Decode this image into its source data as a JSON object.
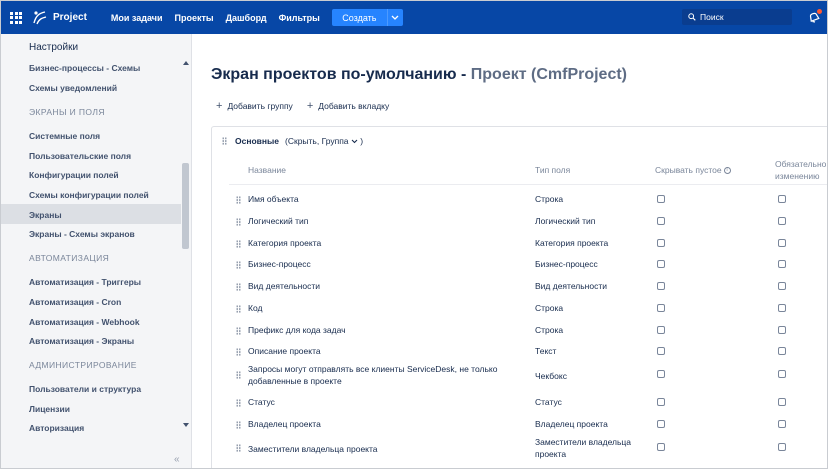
{
  "topbar": {
    "brand": "Project",
    "nav": [
      "Мои задачи",
      "Проекты",
      "Дашборд",
      "Фильтры"
    ],
    "create_label": "Создать",
    "search_placeholder": "Поиск"
  },
  "sidebar": {
    "title": "Настройки",
    "items": [
      {
        "type": "item",
        "label": "Бизнес-процессы - Схемы"
      },
      {
        "type": "item",
        "label": "Схемы уведомлений"
      },
      {
        "type": "head",
        "label": "ЭКРАНЫ И ПОЛЯ"
      },
      {
        "type": "item",
        "label": "Системные поля"
      },
      {
        "type": "item",
        "label": "Пользовательские поля"
      },
      {
        "type": "item",
        "label": "Конфигурации полей"
      },
      {
        "type": "item",
        "label": "Схемы конфигурации полей"
      },
      {
        "type": "item",
        "label": "Экраны"
      },
      {
        "type": "item",
        "label": "Экраны - Схемы экранов"
      },
      {
        "type": "head",
        "label": "АВТОМАТИЗАЦИЯ"
      },
      {
        "type": "item",
        "label": "Автоматизация - Триггеры"
      },
      {
        "type": "item",
        "label": "Автоматизация - Cron"
      },
      {
        "type": "item",
        "label": "Автоматизация - Webhook"
      },
      {
        "type": "item",
        "label": "Автоматизация - Экраны"
      },
      {
        "type": "head",
        "label": "АДМИНИСТРИРОВАНИЕ"
      },
      {
        "type": "item",
        "label": "Пользователи и структура"
      },
      {
        "type": "item",
        "label": "Лицензии"
      },
      {
        "type": "item",
        "label": "Авторизация"
      }
    ],
    "active": "Экраны",
    "collapse_glyph": "«"
  },
  "main": {
    "title": "Экран проектов по-умолчанию - ",
    "title_project": "Проект (CmfProject)",
    "add_group": "Добавить группу",
    "add_tab": "Добавить вкладку",
    "group_name": "Основные",
    "group_meta": "(Скрыть, Группа",
    "group_meta_end": ")",
    "columns": {
      "name": "Название",
      "type": "Тип поля",
      "hide_empty": "Скрывать пустое",
      "required_1": "Обязательно",
      "required_2": "изменению"
    },
    "rows": [
      {
        "name": "Имя объекта",
        "type": "Строка"
      },
      {
        "name": "Логический тип",
        "type": "Логический тип"
      },
      {
        "name": "Категория проекта",
        "type": "Категория проекта"
      },
      {
        "name": "Бизнес-процесс",
        "type": "Бизнес-процесс"
      },
      {
        "name": "Вид деятельности",
        "type": "Вид деятельности"
      },
      {
        "name": "Код",
        "type": "Строка"
      },
      {
        "name": "Префикс для кода задач",
        "type": "Строка"
      },
      {
        "name": "Описание проекта",
        "type": "Текст"
      },
      {
        "name": "Запросы могут отправлять все клиенты ServiceDesk, не только добавленные в проекте",
        "type": "Чекбокс"
      },
      {
        "name": "Статус",
        "type": "Статус"
      },
      {
        "name": "Владелец проекта",
        "type": "Владелец проекта"
      },
      {
        "name": "Заместители владельца проекта",
        "type": "Заместители владельца проекта"
      }
    ]
  },
  "colors": {
    "topbar": "#0747a6",
    "create_button": "#2684ff",
    "sidebar_bg": "#f4f5f7",
    "active_item": "#dcdfe4"
  }
}
